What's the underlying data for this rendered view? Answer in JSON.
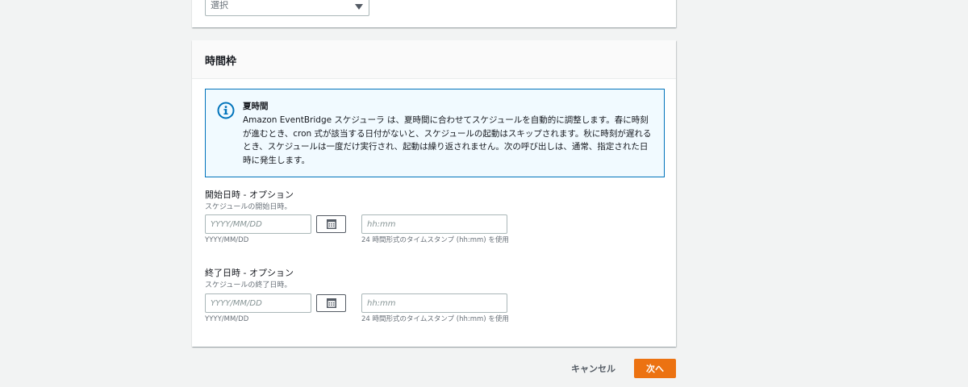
{
  "top_panel": {
    "select_value": "選択"
  },
  "timeframe": {
    "title": "時間枠",
    "info": {
      "icon": "info-icon",
      "title": "夏時間",
      "body": "Amazon EventBridge スケジューラ は、夏時間に合わせてスケジュールを自動的に調整します。春に時刻が進むとき、cron 式が該当する日付がないと、スケジュールの起動はスキップされます。秋に時刻が遅れるとき、スケジュールは一度だけ実行され、起動は繰り返されません。次の呼び出しは、通常、指定された日時に発生します。"
    },
    "start": {
      "label": "開始日時 - オプション",
      "description": "スケジュールの開始日時。",
      "date_placeholder": "YYYY/MM/DD",
      "date_hint": "YYYY/MM/DD",
      "time_placeholder": "hh:mm",
      "time_hint": "24 時間形式のタイムスタンプ (hh:mm) を使用"
    },
    "end": {
      "label": "終了日時 - オプション",
      "description": "スケジュールの終了日時。",
      "date_placeholder": "YYYY/MM/DD",
      "date_hint": "YYYY/MM/DD",
      "time_placeholder": "hh:mm",
      "time_hint": "24 時間形式のタイムスタンプ (hh:mm) を使用"
    }
  },
  "footer": {
    "cancel_label": "キャンセル",
    "next_label": "次へ"
  },
  "colors": {
    "primary_button": "#ec7211",
    "info_border": "#0073bb",
    "info_background": "#f1faff",
    "page_background": "#f2f3f3"
  }
}
